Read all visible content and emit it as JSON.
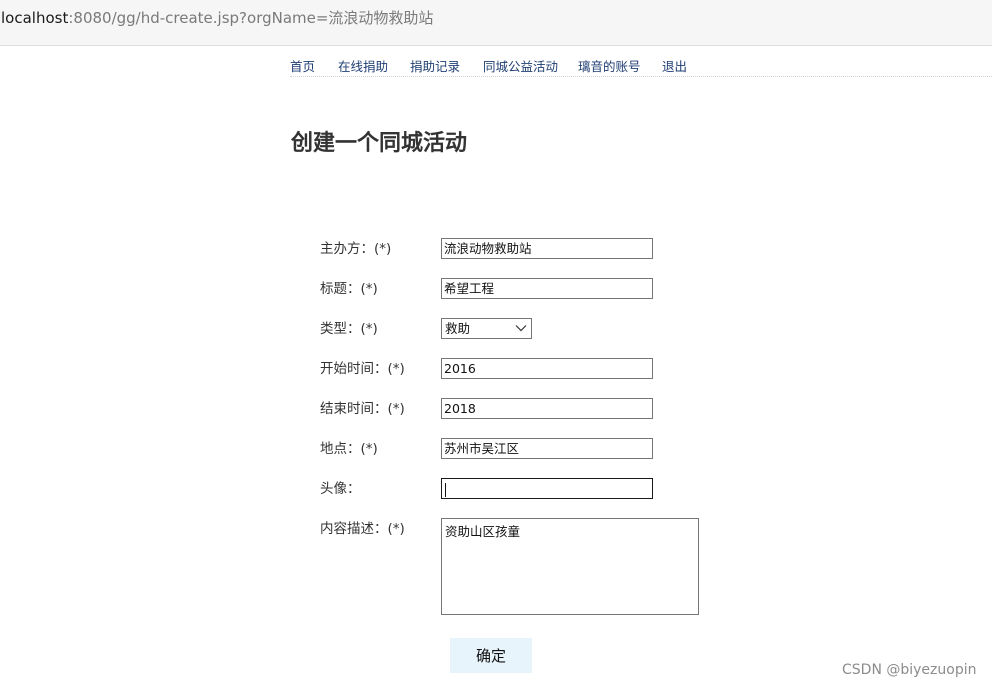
{
  "browser": {
    "url_host": "localhost",
    "url_rest": ":8080/gg/hd-create.jsp?orgName=流浪动物救助站"
  },
  "nav": [
    "首页",
    "在线捐助",
    "捐助记录",
    "同城公益活动",
    "璃音的账号",
    "退出"
  ],
  "page_title": "创建一个同城活动",
  "form": {
    "organizer": {
      "label": "主办方：(*)",
      "value": "流浪动物救助站"
    },
    "title": {
      "label": "标题：(*)",
      "value": "希望工程"
    },
    "type": {
      "label": "类型：(*)",
      "selected": "救助"
    },
    "start_time": {
      "label": "开始时间：(*)",
      "value": "2016"
    },
    "end_time": {
      "label": "结束时间：(*)",
      "value": "2018"
    },
    "location": {
      "label": "地点：(*)",
      "value": "苏州市吴江区"
    },
    "avatar": {
      "label": "头像：",
      "value": ""
    },
    "description": {
      "label": "内容描述：(*)",
      "value": "资助山区孩童"
    },
    "submit_label": "确定"
  },
  "watermark": "CSDN @biyezuopin"
}
